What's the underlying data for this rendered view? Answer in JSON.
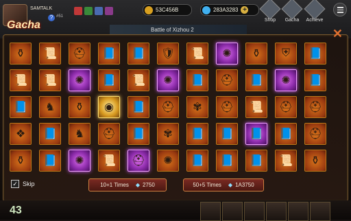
{
  "player": {
    "name": "SAMTALK",
    "level_text": "#51"
  },
  "resources": {
    "gold": {
      "value": "53C456B",
      "color": "#d8a020"
    },
    "gems": {
      "value": "283A3283",
      "color": "#40b0f0"
    }
  },
  "nav": [
    {
      "label": "Shop",
      "icon": "shop-icon"
    },
    {
      "label": "Gacha",
      "icon": "gacha-icon"
    },
    {
      "label": "Achieve",
      "icon": "achieve-icon"
    }
  ],
  "banner": {
    "text": "Battle of Xizhou  2"
  },
  "gacha": {
    "title": "Gacha",
    "items": [
      [
        "potion",
        "scroll",
        "helmet",
        "book",
        "book",
        "armor",
        "scroll",
        "rune",
        "potion",
        "shield",
        "book"
      ],
      [
        "scroll",
        "scroll",
        "rune",
        "book",
        "scroll",
        "rune",
        "book",
        "helmet",
        "book",
        "rune",
        "book"
      ],
      [
        "book",
        "horse",
        "potion",
        "coin",
        "book",
        "helmet",
        "fan",
        "helmet",
        "scroll",
        "helmet",
        "helmet"
      ],
      [
        "jade",
        "book",
        "horse",
        "helmet",
        "book",
        "fan",
        "book",
        "book",
        "book",
        "book",
        "helmet"
      ],
      [
        "potion",
        "book",
        "rune",
        "scroll",
        "helmet",
        "rune",
        "book",
        "book",
        "book",
        "scroll",
        "potion"
      ]
    ],
    "rarity": [
      [
        "o",
        "o",
        "o",
        "o",
        "o",
        "o",
        "o",
        "p",
        "o",
        "o",
        "o"
      ],
      [
        "o",
        "o",
        "p",
        "o",
        "o",
        "p",
        "o",
        "o",
        "o",
        "p",
        "o"
      ],
      [
        "o",
        "o",
        "o",
        "g",
        "o",
        "o",
        "o",
        "o",
        "o",
        "o",
        "o"
      ],
      [
        "o",
        "o",
        "o",
        "o",
        "o",
        "o",
        "o",
        "o",
        "p",
        "o",
        "o"
      ],
      [
        "o",
        "o",
        "p",
        "o",
        "p",
        "o",
        "o",
        "o",
        "o",
        "o",
        "o"
      ]
    ]
  },
  "skip": {
    "label": "Skip",
    "checked": true
  },
  "buttons": [
    {
      "label": "10+1 Times",
      "cost": "2750"
    },
    {
      "label": "50+5 Times",
      "cost": "1A3750"
    }
  ],
  "footer": {
    "value": "43"
  }
}
